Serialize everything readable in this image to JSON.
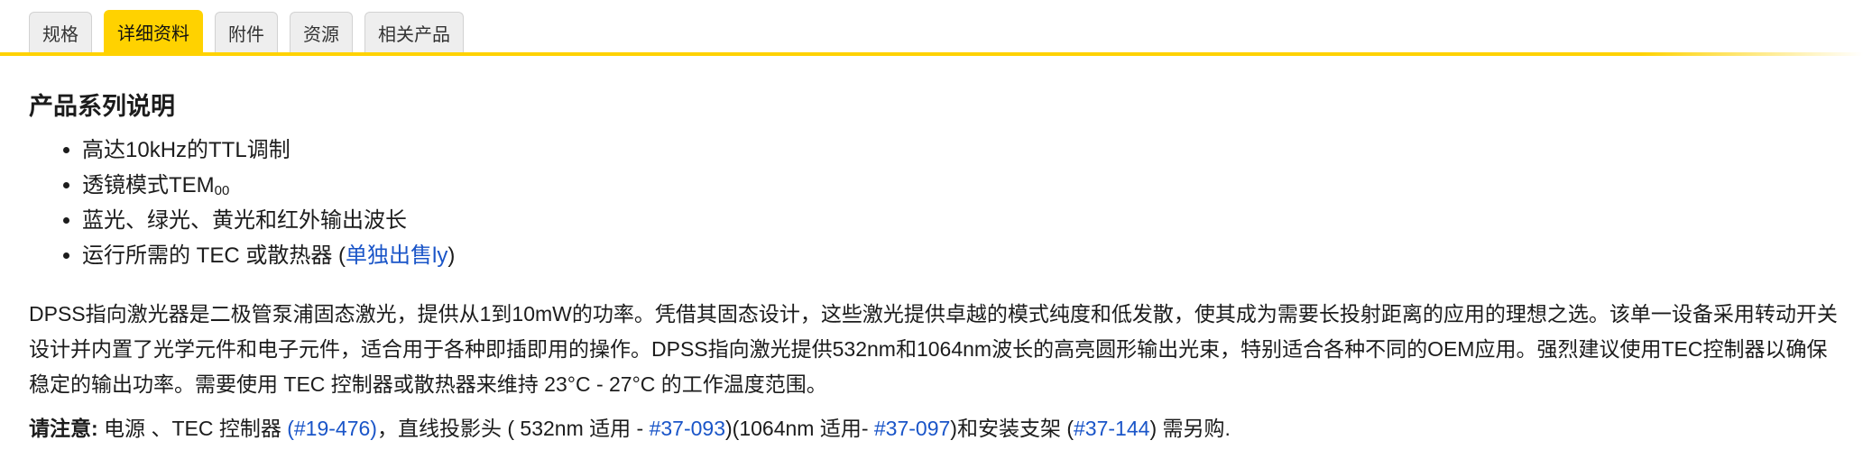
{
  "tabs": [
    {
      "label": "规格",
      "active": false
    },
    {
      "label": "详细资料",
      "active": true
    },
    {
      "label": "附件",
      "active": false
    },
    {
      "label": "资源",
      "active": false
    },
    {
      "label": "相关产品",
      "active": false
    }
  ],
  "colors": {
    "accent": "#ffd200",
    "link": "#1a55c8"
  },
  "section": {
    "title": "产品系列说明",
    "features": {
      "f1": "高达10kHz的TTL调制",
      "f2_text": "透镜模式TEM",
      "f2_sub": "00",
      "f3": "蓝光、绿光、黄光和红外输出波长",
      "f4_pre": "运行所需的 TEC 或散热器 (",
      "f4_link": "单独出售ly",
      "f4_post": ")"
    },
    "description": "DPSS指向激光器是二极管泵浦固态激光，提供从1到10mW的功率。凭借其固态设计，这些激光提供卓越的模式纯度和低发散，使其成为需要长投射距离的应用的理想之选。该单一设备采用转动开关设计并内置了光学元件和电子元件，适合用于各种即插即用的操作。DPSS指向激光提供532nm和1064nm波长的高亮圆形输出光束，特别适合各种不同的OEM应用。强烈建议使用TEC控制器以确保稳定的输出功率。需要使用 TEC 控制器或散热器来维持 23°C - 27°C 的工作温度范围。",
    "note": {
      "label": "请注意:",
      "t1": " 电源 、TEC 控制器 ",
      "link1": "(#19-476)",
      "t2": "，直线投影头 ( 532nm 适用 - ",
      "link2": "#37-093",
      "t3": ")(1064nm 适用- ",
      "link3": "#37-097",
      "t4": ")和安装支架 (",
      "link4": "#37-144",
      "t5": ") 需另购."
    }
  }
}
